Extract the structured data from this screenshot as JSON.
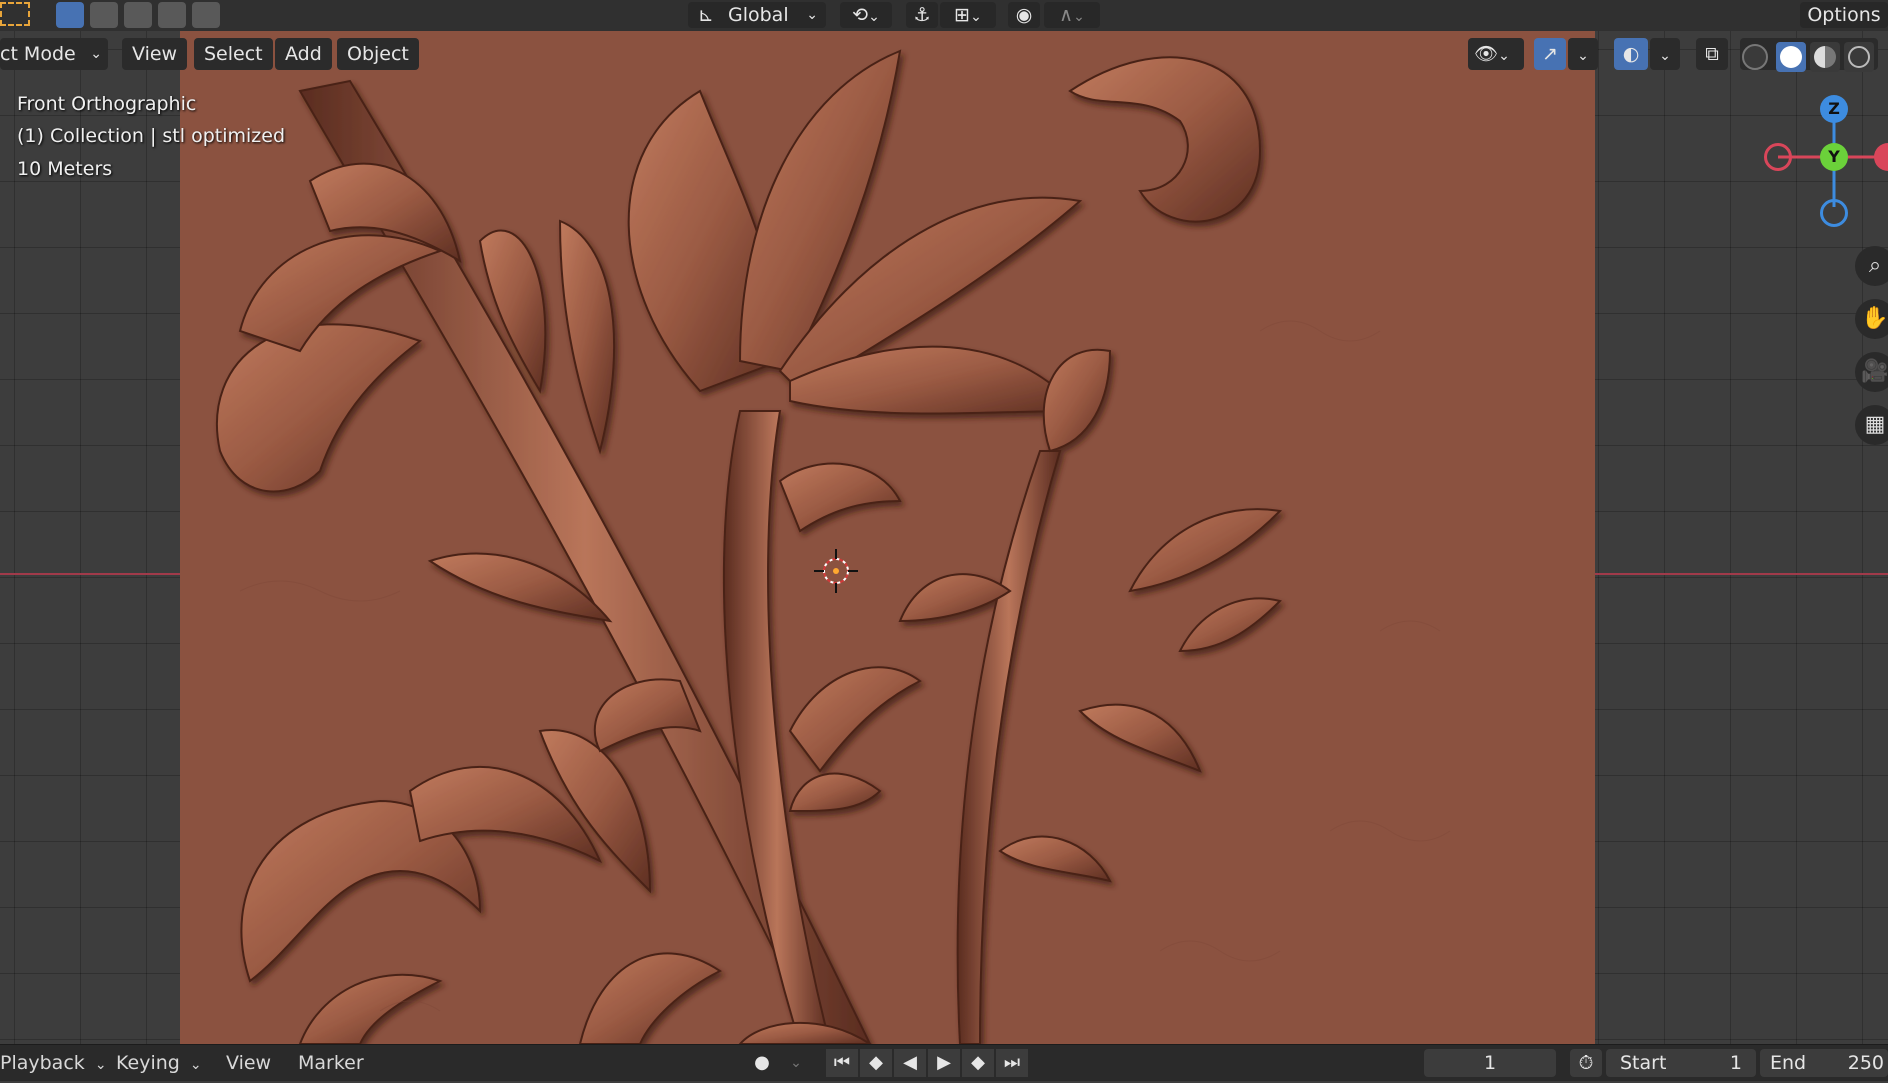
{
  "header": {
    "orientation_label": "Global",
    "options_label": "Options"
  },
  "viewport_header": {
    "mode_label": "ct Mode",
    "menu": [
      "View",
      "Select",
      "Add",
      "Object"
    ]
  },
  "overlay": {
    "view_name": "Front Orthographic",
    "collection": "(1) Collection | stl optimized",
    "scale": "10 Meters"
  },
  "gizmo": {
    "z": "Z",
    "y": "Y"
  },
  "timeline": {
    "playback": "Playback",
    "keying": "Keying",
    "view": "View",
    "marker": "Marker",
    "current_frame": "1",
    "start_label": "Start",
    "start_value": "1",
    "end_label": "End",
    "end_value": "250"
  },
  "colors": {
    "relief": "#8b5240",
    "grid_bg": "#3d3d3d",
    "x_axis": "#a13a4a",
    "axis_x": "#d9465a",
    "axis_y": "#6bd13a",
    "axis_z": "#3d8ce0",
    "accent": "#4772b3"
  },
  "icons": [
    "select-box-icon",
    "transform-pivot-icon",
    "snap-icon",
    "proportional-edit-icon",
    "visibility-icon",
    "gizmo-icon",
    "overlay-icon",
    "xray-icon",
    "wireframe-shading-icon",
    "solid-shading-icon",
    "material-shading-icon",
    "rendered-shading-icon",
    "zoom-icon",
    "hand-pan-icon",
    "camera-icon",
    "grid-icon",
    "stopwatch-icon"
  ]
}
